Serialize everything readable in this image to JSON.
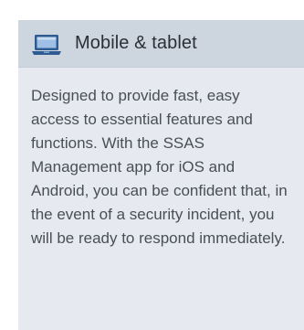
{
  "card": {
    "title": "Mobile & tablet",
    "icon": "laptop-icon",
    "description": "Designed to provide fast, easy access to essential features and functions. With the SSAS Management app for iOS and Android, you can be confident that, in the event of a security incident, you will be ready to respond immediately."
  },
  "colors": {
    "card_background": "#e6eaf0",
    "header_background": "#cdd5df",
    "icon_accent": "#2f5b93"
  }
}
